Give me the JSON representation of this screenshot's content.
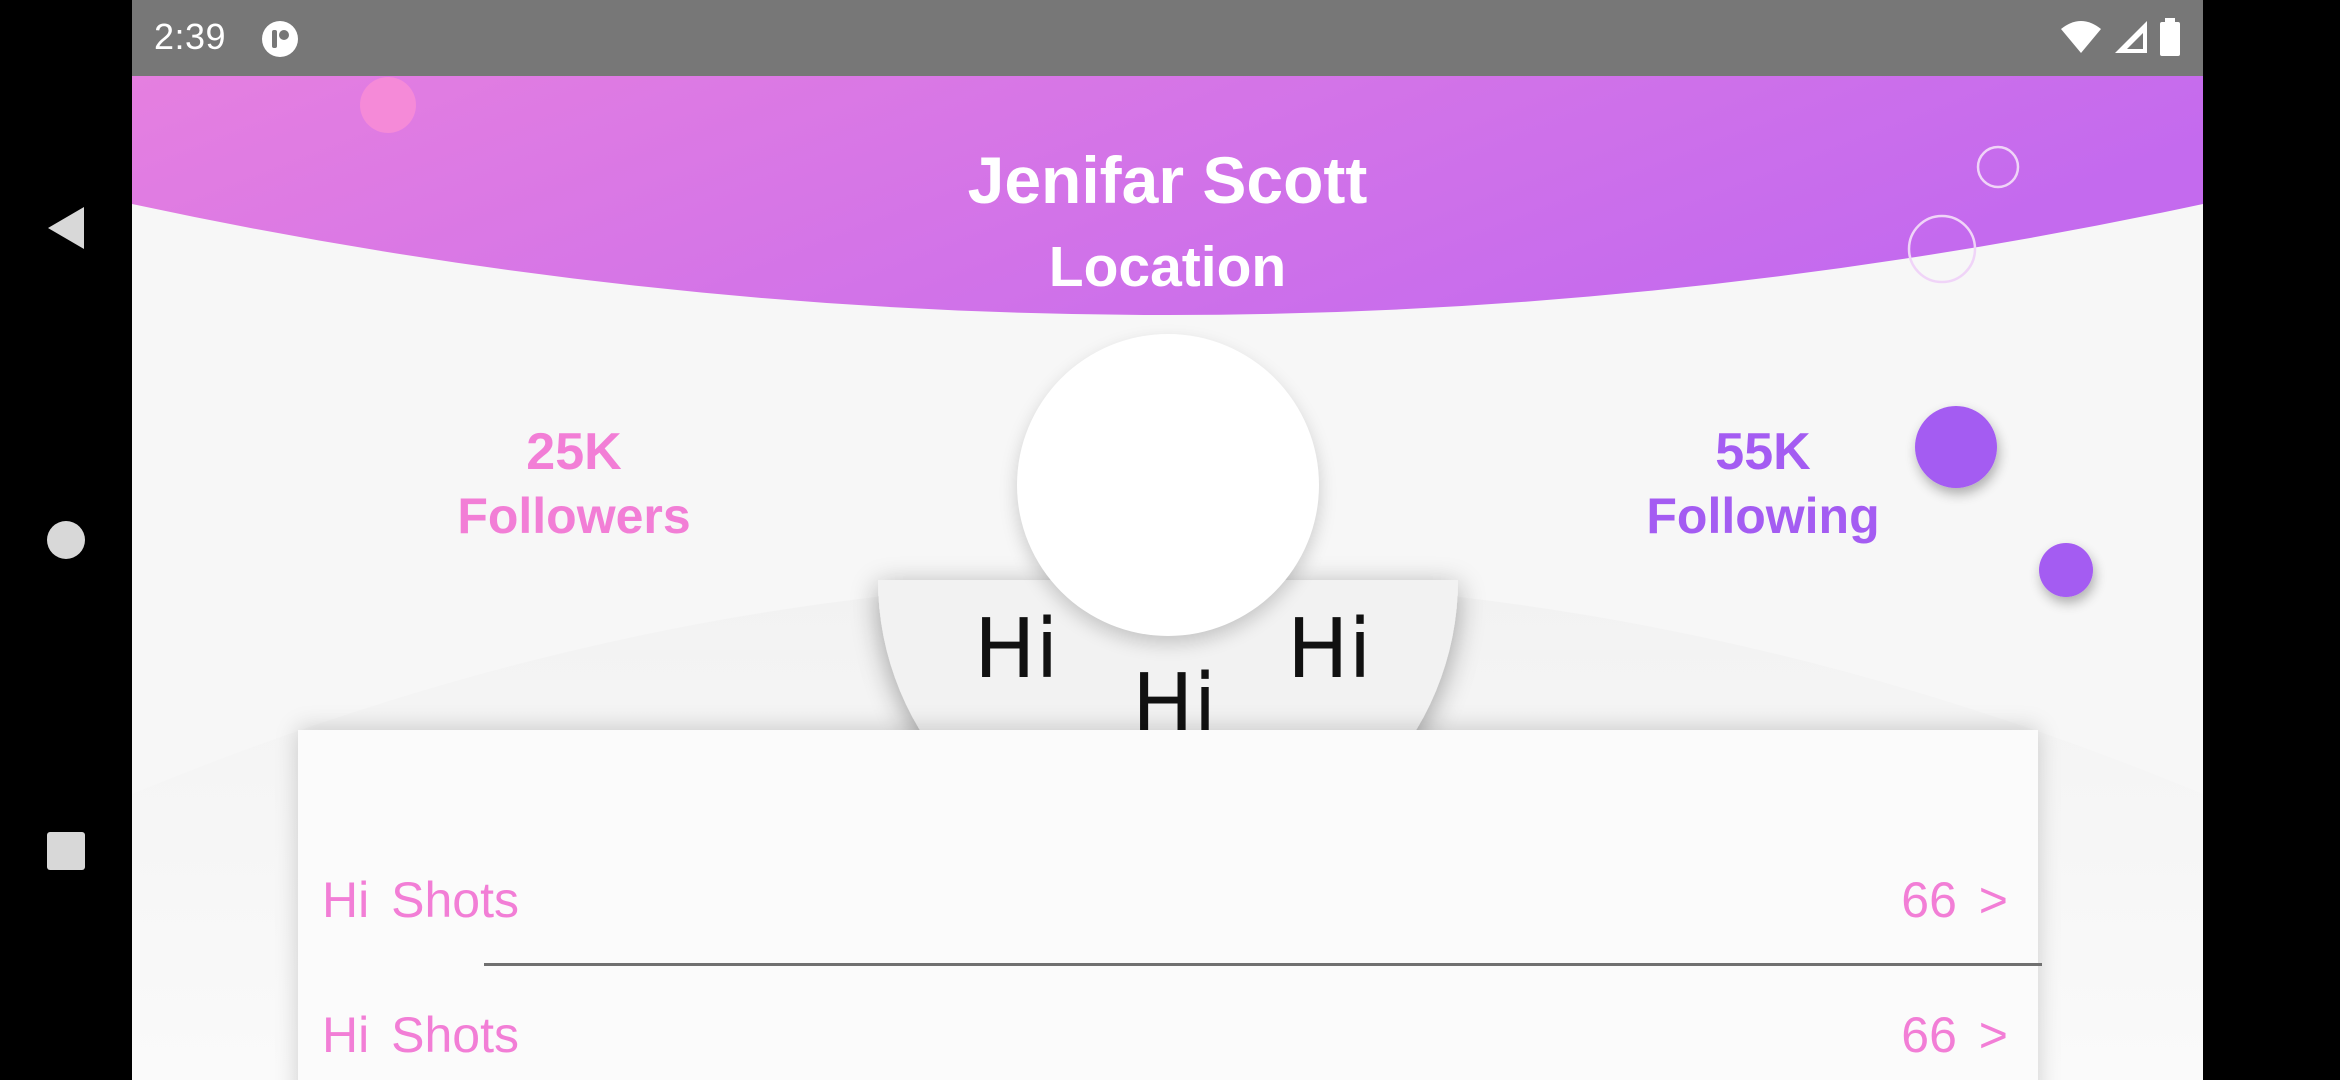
{
  "status_bar": {
    "time": "2:39",
    "icons": [
      "app-notification-icon",
      "wifi-icon",
      "cellular-signal-icon",
      "battery-icon"
    ]
  },
  "profile": {
    "name": "Jenifar Scott",
    "location": "Location"
  },
  "stats": {
    "followers": {
      "count": "25K",
      "label": "Followers"
    },
    "following": {
      "count": "55K",
      "label": "Following"
    }
  },
  "greetings": [
    "Hi",
    "Hi",
    "Hi"
  ],
  "list": {
    "items": [
      {
        "title": "Hi Shots",
        "count": "66 >"
      },
      {
        "title": "Hi Shots",
        "count": "66 >"
      }
    ]
  },
  "colors": {
    "header_gradient_start": "#e57fe0",
    "header_gradient_end": "#c46aee",
    "accent_pink": "#f27ed6",
    "accent_purple": "#a45cf2",
    "status_bar": "#777777",
    "background": "#f7f7f7"
  },
  "navigation": [
    "back-icon",
    "home-icon",
    "recents-icon"
  ]
}
